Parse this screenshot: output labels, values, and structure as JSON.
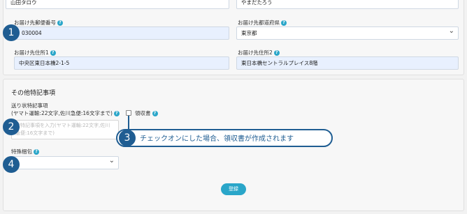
{
  "top": {
    "name_value": "山田タロウ",
    "name_kana_value": "やまだたろう",
    "postal_label": "お届け先郵便番号",
    "postal_value": "030004",
    "prefecture_label": "お届け先都道府県",
    "prefecture_value": "東京都",
    "address1_label": "お届け先住所1",
    "address1_value": "中央区東日本橋2-1-5",
    "address2_label": "お届け先住所2",
    "address2_value": "東日本橋セントラルプレイス8階"
  },
  "other": {
    "section_title": "その他特記事項",
    "slip_label": "送り状特記事項",
    "slip_sublabel": "(ヤマト運輸:22文字,佐川急便:16文字まで)",
    "slip_placeholder": "状特記事項を入力(ヤマト運輸:22文字,佐川急便:16文字まで)",
    "receipt_label": "領収書",
    "packing_label": "特殊梱包",
    "packing_value": "",
    "submit_label": "登録"
  },
  "annotations": {
    "m1": "1",
    "m2": "2",
    "m3": "3",
    "m4": "4",
    "callout": "チェックオンにした場合、領収書が作成されます"
  },
  "icons": {
    "help": "question-circle-icon",
    "dropdown": "chevron-down-icon"
  },
  "colors": {
    "accent": "#2aa6c9",
    "marker": "#1f5d92",
    "input_fill": "#e8f0fe"
  }
}
